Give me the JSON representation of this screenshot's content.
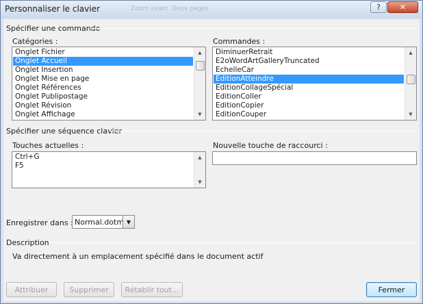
{
  "window": {
    "title": "Personnaliser le clavier",
    "background_text": [
      "Zoom avant",
      "Deux pages"
    ],
    "help_label": "?",
    "close_label": "✕"
  },
  "specify_command": {
    "section_label": "Spécifier une commande",
    "categories": {
      "label": "Catégories :",
      "items": [
        "Onglet Fichier",
        "Onglet Accueil",
        "Onglet Insertion",
        "Onglet Mise en page",
        "Onglet Références",
        "Onglet Publipostage",
        "Onglet Révision",
        "Onglet Affichage"
      ],
      "selected": "Onglet Accueil"
    },
    "commands": {
      "label": "Commandes :",
      "items": [
        "DiminuerRetrait",
        "E2oWordArtGalleryTruncated",
        "EchelleCar",
        "EditionAtteindre",
        "EditionCollageSpécial",
        "EditionColler",
        "EditionCopier",
        "EditionCouper"
      ],
      "selected": "EditionAtteindre"
    }
  },
  "key_sequence": {
    "section_label": "Spécifier une séquence clavier",
    "current_keys": {
      "label": "Touches actuelles :",
      "items": [
        "Ctrl+G",
        "F5"
      ]
    },
    "new_shortcut": {
      "label": "Nouvelle touche de raccourci :",
      "value": ""
    }
  },
  "save_in": {
    "label": "Enregistrer dans :",
    "value": "Normal.dotm"
  },
  "description": {
    "section_label": "Description",
    "text": "Va directement à un emplacement spécifié dans le document actif"
  },
  "buttons": {
    "assign": "Attribuer",
    "remove": "Supprimer",
    "reset_all": "Rétablir tout...",
    "close": "Fermer"
  },
  "colors": {
    "selection": "#3399ff",
    "frame": "#d6e2f0"
  }
}
